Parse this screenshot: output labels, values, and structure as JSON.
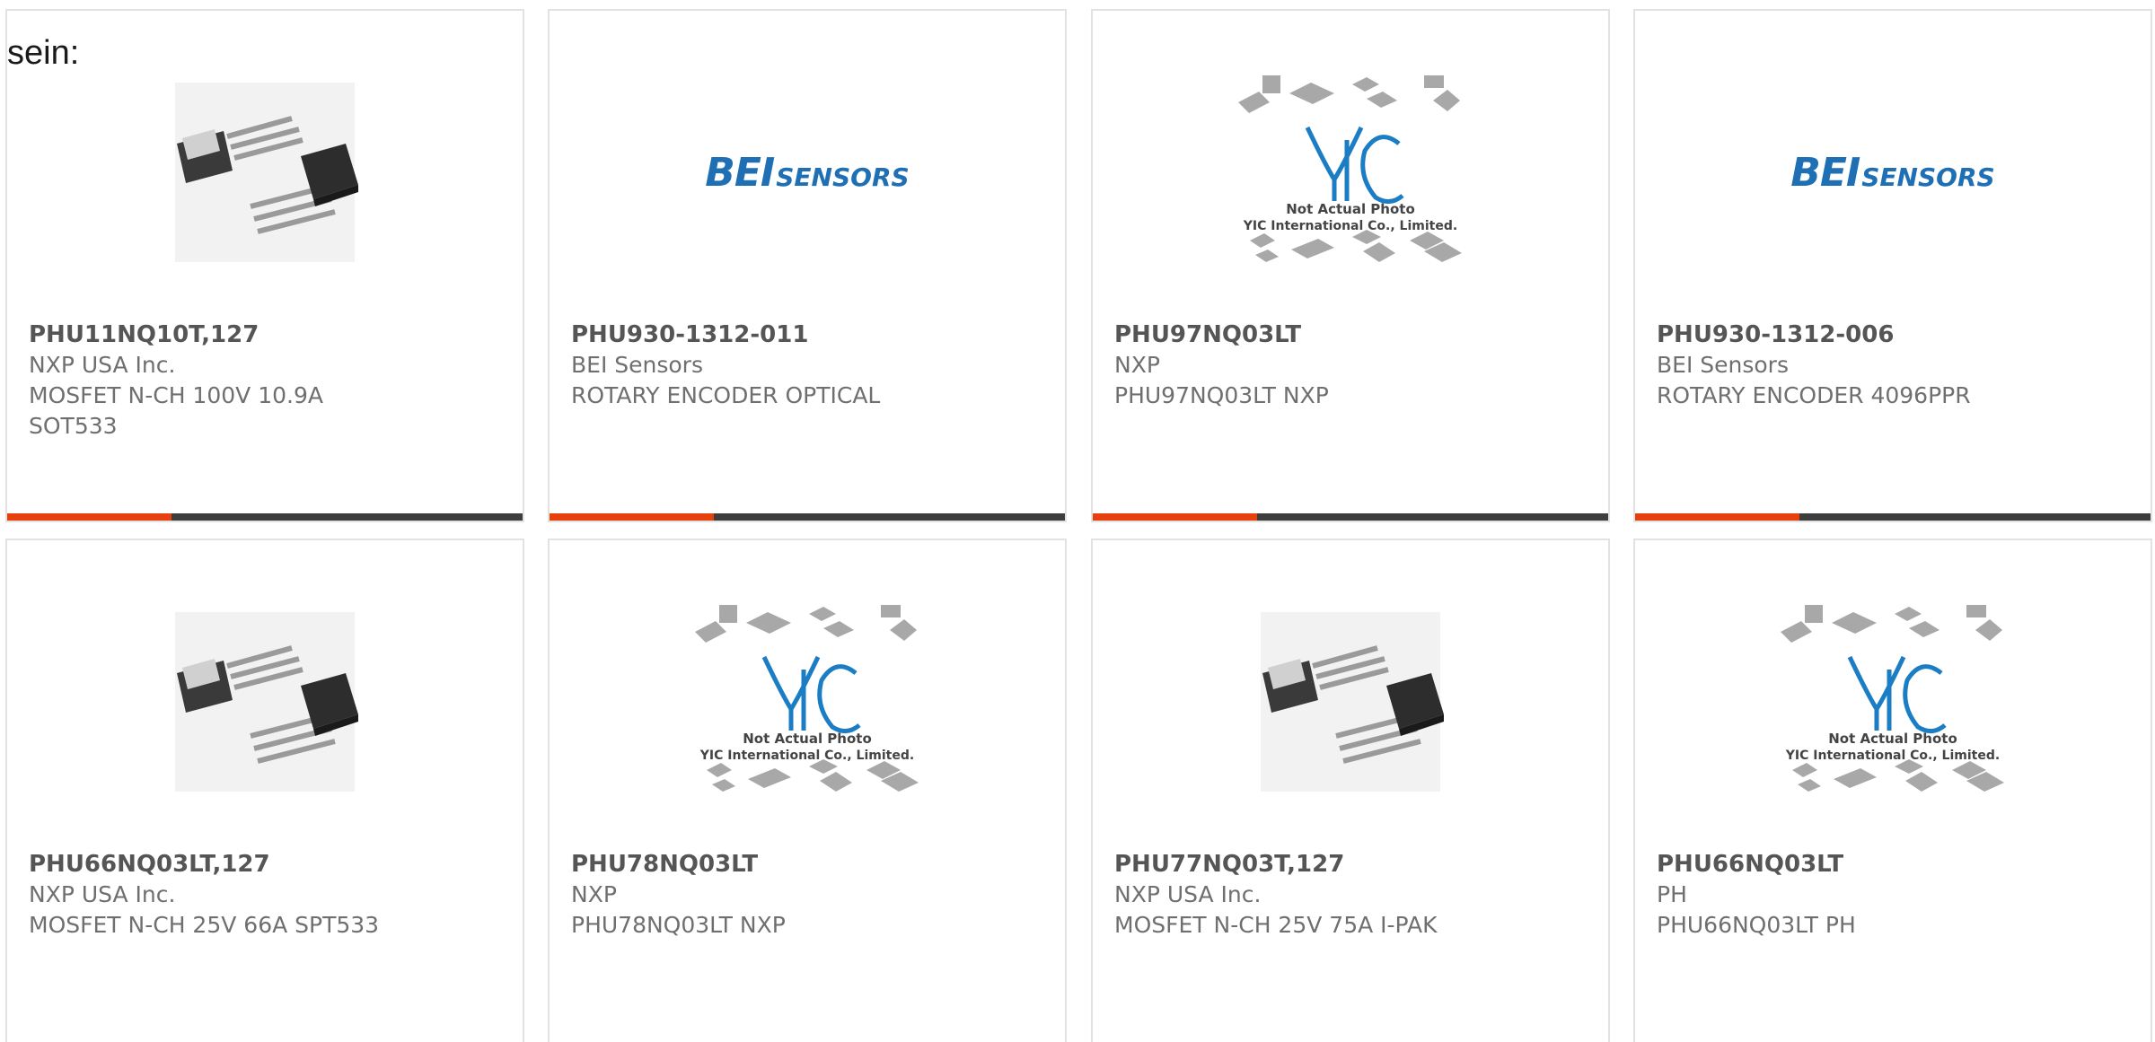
{
  "intro_text": "sein:",
  "cards": [
    {
      "part_number": "PHU11NQ10T,127",
      "manufacturer": "NXP USA Inc.",
      "description_1": "MOSFET N-CH 100V 10.9A",
      "description_2": "SOT533",
      "image": "to251-package-photo"
    },
    {
      "part_number": "PHU930-1312-011",
      "manufacturer": "BEI Sensors",
      "description_1": "ROTARY ENCODER OPTICAL",
      "description_2": "",
      "image": "bei-sensors-logo",
      "logo_word_1": "BEI",
      "logo_word_2": "SENSORS"
    },
    {
      "part_number": "PHU97NQ03LT",
      "manufacturer": "NXP",
      "description_1": "PHU97NQ03LT NXP",
      "description_2": "",
      "image": "yic-placeholder",
      "placeholder_line_1": "Not Actual Photo",
      "placeholder_line_2": "YIC International Co., Limited."
    },
    {
      "part_number": "PHU930-1312-006",
      "manufacturer": "BEI Sensors",
      "description_1": "ROTARY ENCODER 4096PPR",
      "description_2": "",
      "image": "bei-sensors-logo",
      "logo_word_1": "BEI",
      "logo_word_2": "SENSORS"
    },
    {
      "part_number": "PHU66NQ03LT,127",
      "manufacturer": "NXP USA Inc.",
      "description_1": "MOSFET N-CH 25V 66A SPT533",
      "description_2": "",
      "image": "to251-package-photo"
    },
    {
      "part_number": "PHU78NQ03LT",
      "manufacturer": "NXP",
      "description_1": "PHU78NQ03LT NXP",
      "description_2": "",
      "image": "yic-placeholder",
      "placeholder_line_1": "Not Actual Photo",
      "placeholder_line_2": "YIC International Co., Limited."
    },
    {
      "part_number": "PHU77NQ03T,127",
      "manufacturer": "NXP USA Inc.",
      "description_1": "MOSFET N-CH 25V 75A I-PAK",
      "description_2": "",
      "image": "to251-package-photo"
    },
    {
      "part_number": "PHU66NQ03LT",
      "manufacturer": "PH",
      "description_1": "PHU66NQ03LT PH",
      "description_2": "",
      "image": "yic-placeholder",
      "placeholder_line_1": "Not Actual Photo",
      "placeholder_line_2": "YIC International Co., Limited."
    }
  ],
  "colors": {
    "accent_bar": "#e8400c",
    "dark_bar": "#3d3d3d",
    "bei_blue": "#1f6fb5",
    "yic_blue": "#1b7dc4"
  }
}
